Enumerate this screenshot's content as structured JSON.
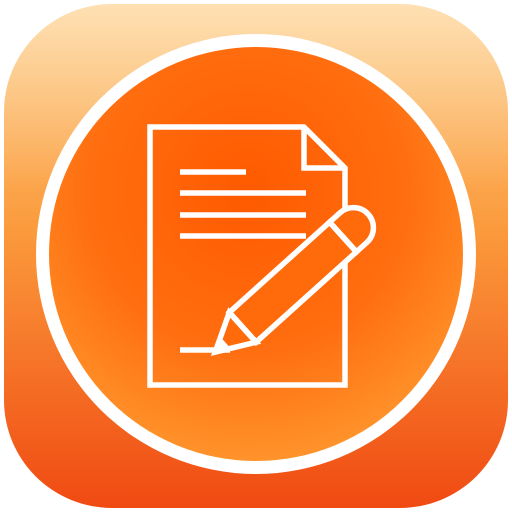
{
  "app_icon": {
    "icon": "document-edit-icon",
    "colors": {
      "tile_top": "#fdd08a",
      "tile_mid": "#fb9a3c",
      "tile_bottom": "#f04a12",
      "disc_center": "#ff5a00",
      "disc_edge": "#ff9a30",
      "ring": "#ffffff",
      "glyph_stroke": "#ffffff"
    }
  }
}
